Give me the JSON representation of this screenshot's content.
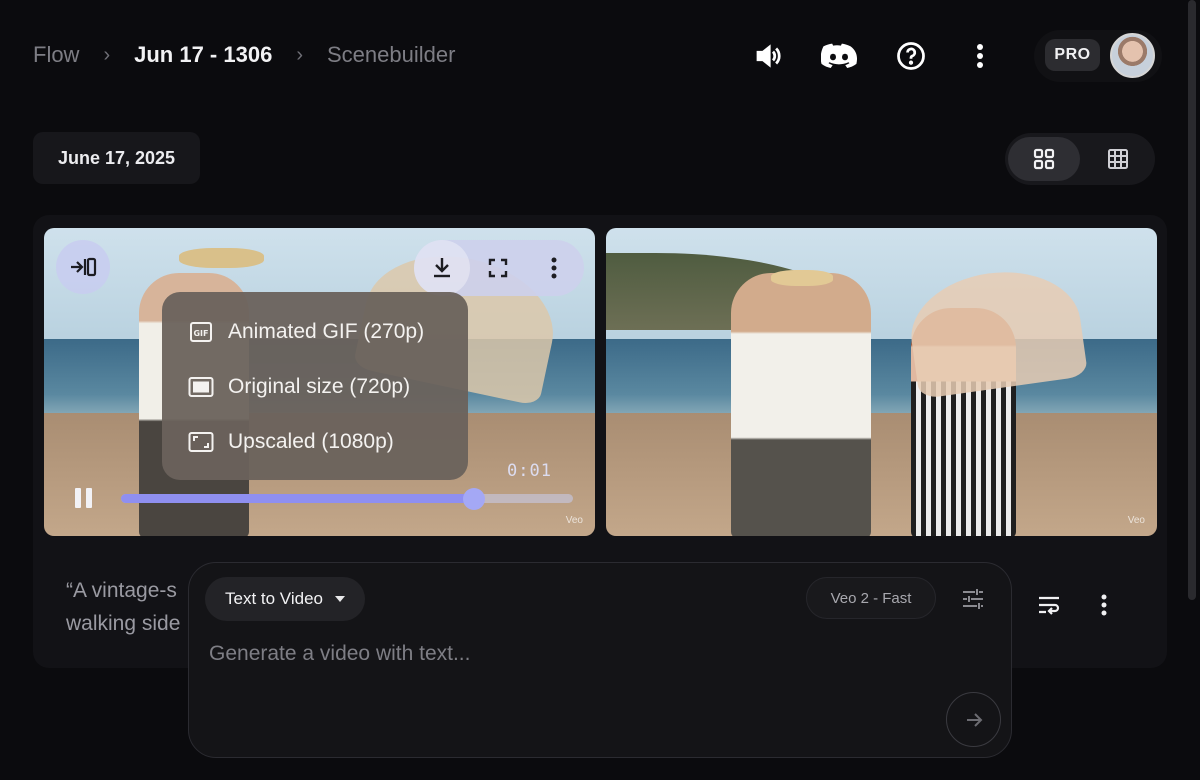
{
  "breadcrumb": {
    "root": "Flow",
    "project": "Jun 17 - 1306",
    "page": "Scenebuilder"
  },
  "header": {
    "icons": [
      "volume-icon",
      "discord-icon",
      "help-icon",
      "more-vert-icon"
    ],
    "plan_badge": "PRO"
  },
  "toolbar": {
    "date_label": "June 17, 2025",
    "view_modes": [
      "grid-2x2",
      "grid-3x3"
    ],
    "active_view": "grid-2x2"
  },
  "clip_left": {
    "timecode": "0:01",
    "progress": 0.78,
    "watermark": "Veo"
  },
  "clip_right": {
    "watermark": "Veo"
  },
  "download_menu": {
    "items": [
      {
        "label": "Animated GIF (270p)",
        "icon": "gif-icon"
      },
      {
        "label": "Original size (720p)",
        "icon": "frame-icon"
      },
      {
        "label": "Upscaled (1080p)",
        "icon": "upscale-icon"
      }
    ]
  },
  "prompt_preview": {
    "line1": "“A vintage-s",
    "line2": "walking side"
  },
  "composer": {
    "mode": "Text to Video",
    "model": "Veo 2 - Fast",
    "placeholder": "Generate a video with text..."
  },
  "colors": {
    "background": "#0b0b0e",
    "accent": "#8f8ff0",
    "menu_bg": "#6a625c"
  }
}
